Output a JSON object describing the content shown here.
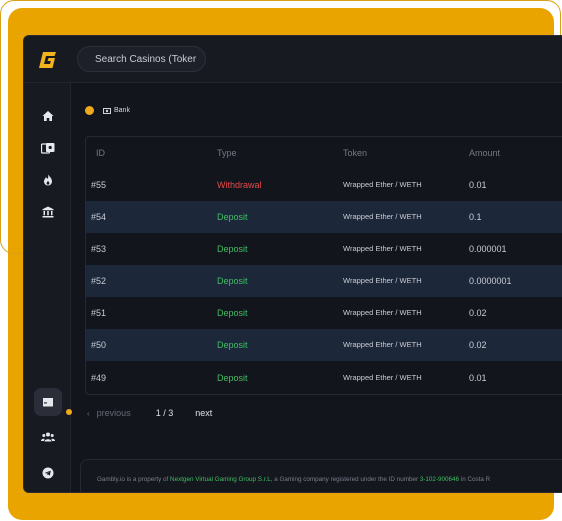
{
  "colors": {
    "accent": "#f0a81c",
    "frame": "#e9a400",
    "withdrawal": "#e34b4b",
    "deposit": "#3fbf63",
    "striped_row": "#1c2739"
  },
  "topbar": {
    "logo": "G",
    "search_placeholder": "Search Casinos (Toker"
  },
  "sidebar": {
    "items": [
      {
        "icon": "home-icon"
      },
      {
        "icon": "casino-chips-icon"
      },
      {
        "icon": "flame-icon"
      },
      {
        "icon": "bank-icon"
      },
      {
        "icon": "wallet-icon",
        "active": true
      },
      {
        "icon": "users-icon"
      },
      {
        "icon": "telegram-icon"
      },
      {
        "icon": "twitter-icon"
      }
    ]
  },
  "bank": {
    "label": "Bank"
  },
  "table": {
    "columns": [
      "ID",
      "Type",
      "Token",
      "Amount"
    ],
    "rows": [
      {
        "id": "#55",
        "type": "Withdrawal",
        "token": "Wrapped Ether / WETH",
        "amount": "0.01"
      },
      {
        "id": "#54",
        "type": "Deposit",
        "token": "Wrapped Ether / WETH",
        "amount": "0.1"
      },
      {
        "id": "#53",
        "type": "Deposit",
        "token": "Wrapped Ether / WETH",
        "amount": "0.000001"
      },
      {
        "id": "#52",
        "type": "Deposit",
        "token": "Wrapped Ether / WETH",
        "amount": "0.0000001"
      },
      {
        "id": "#51",
        "type": "Deposit",
        "token": "Wrapped Ether / WETH",
        "amount": "0.02"
      },
      {
        "id": "#50",
        "type": "Deposit",
        "token": "Wrapped Ether / WETH",
        "amount": "0.02"
      },
      {
        "id": "#49",
        "type": "Deposit",
        "token": "Wrapped Ether / WETH",
        "amount": "0.01"
      }
    ]
  },
  "pager": {
    "prev": "previous",
    "count": "1 / 3",
    "next": "next"
  },
  "footer": {
    "part1": "Gambly.io is a property of ",
    "company": "Nextgen Virtual Gaming Group S.r.L",
    "part2": ", a Gaming company registered under the ID number ",
    "id_number": "3-102-900646",
    "part3": " in Costa R"
  }
}
